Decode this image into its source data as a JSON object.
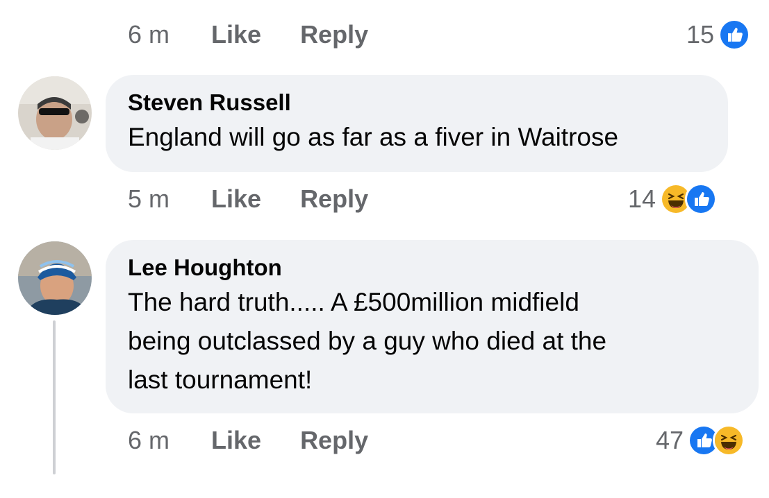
{
  "top_actions": {
    "time": "6 m",
    "like": "Like",
    "reply": "Reply",
    "reaction_count": "15",
    "reaction_icons": [
      "like-icon"
    ]
  },
  "comments": [
    {
      "author": "Steven Russell",
      "text": "England will go as far as a fiver in Waitrose",
      "time": "5 m",
      "like": "Like",
      "reply": "Reply",
      "reaction_count": "14",
      "reaction_icons": [
        "haha-icon",
        "like-icon"
      ]
    },
    {
      "author": "Lee Houghton",
      "text_lines": [
        "The hard truth..... A £500million midfield",
        "being outclassed by a guy who died at the",
        "last tournament!"
      ],
      "time": "6 m",
      "like": "Like",
      "reply": "Reply",
      "reaction_count": "47",
      "reaction_icons": [
        "like-icon",
        "haha-icon"
      ]
    }
  ],
  "colors": {
    "like_blue": "#1877f2",
    "haha_yellow": "#f7b928",
    "bubble_bg": "#f0f2f5",
    "meta_gray": "#65676b"
  }
}
